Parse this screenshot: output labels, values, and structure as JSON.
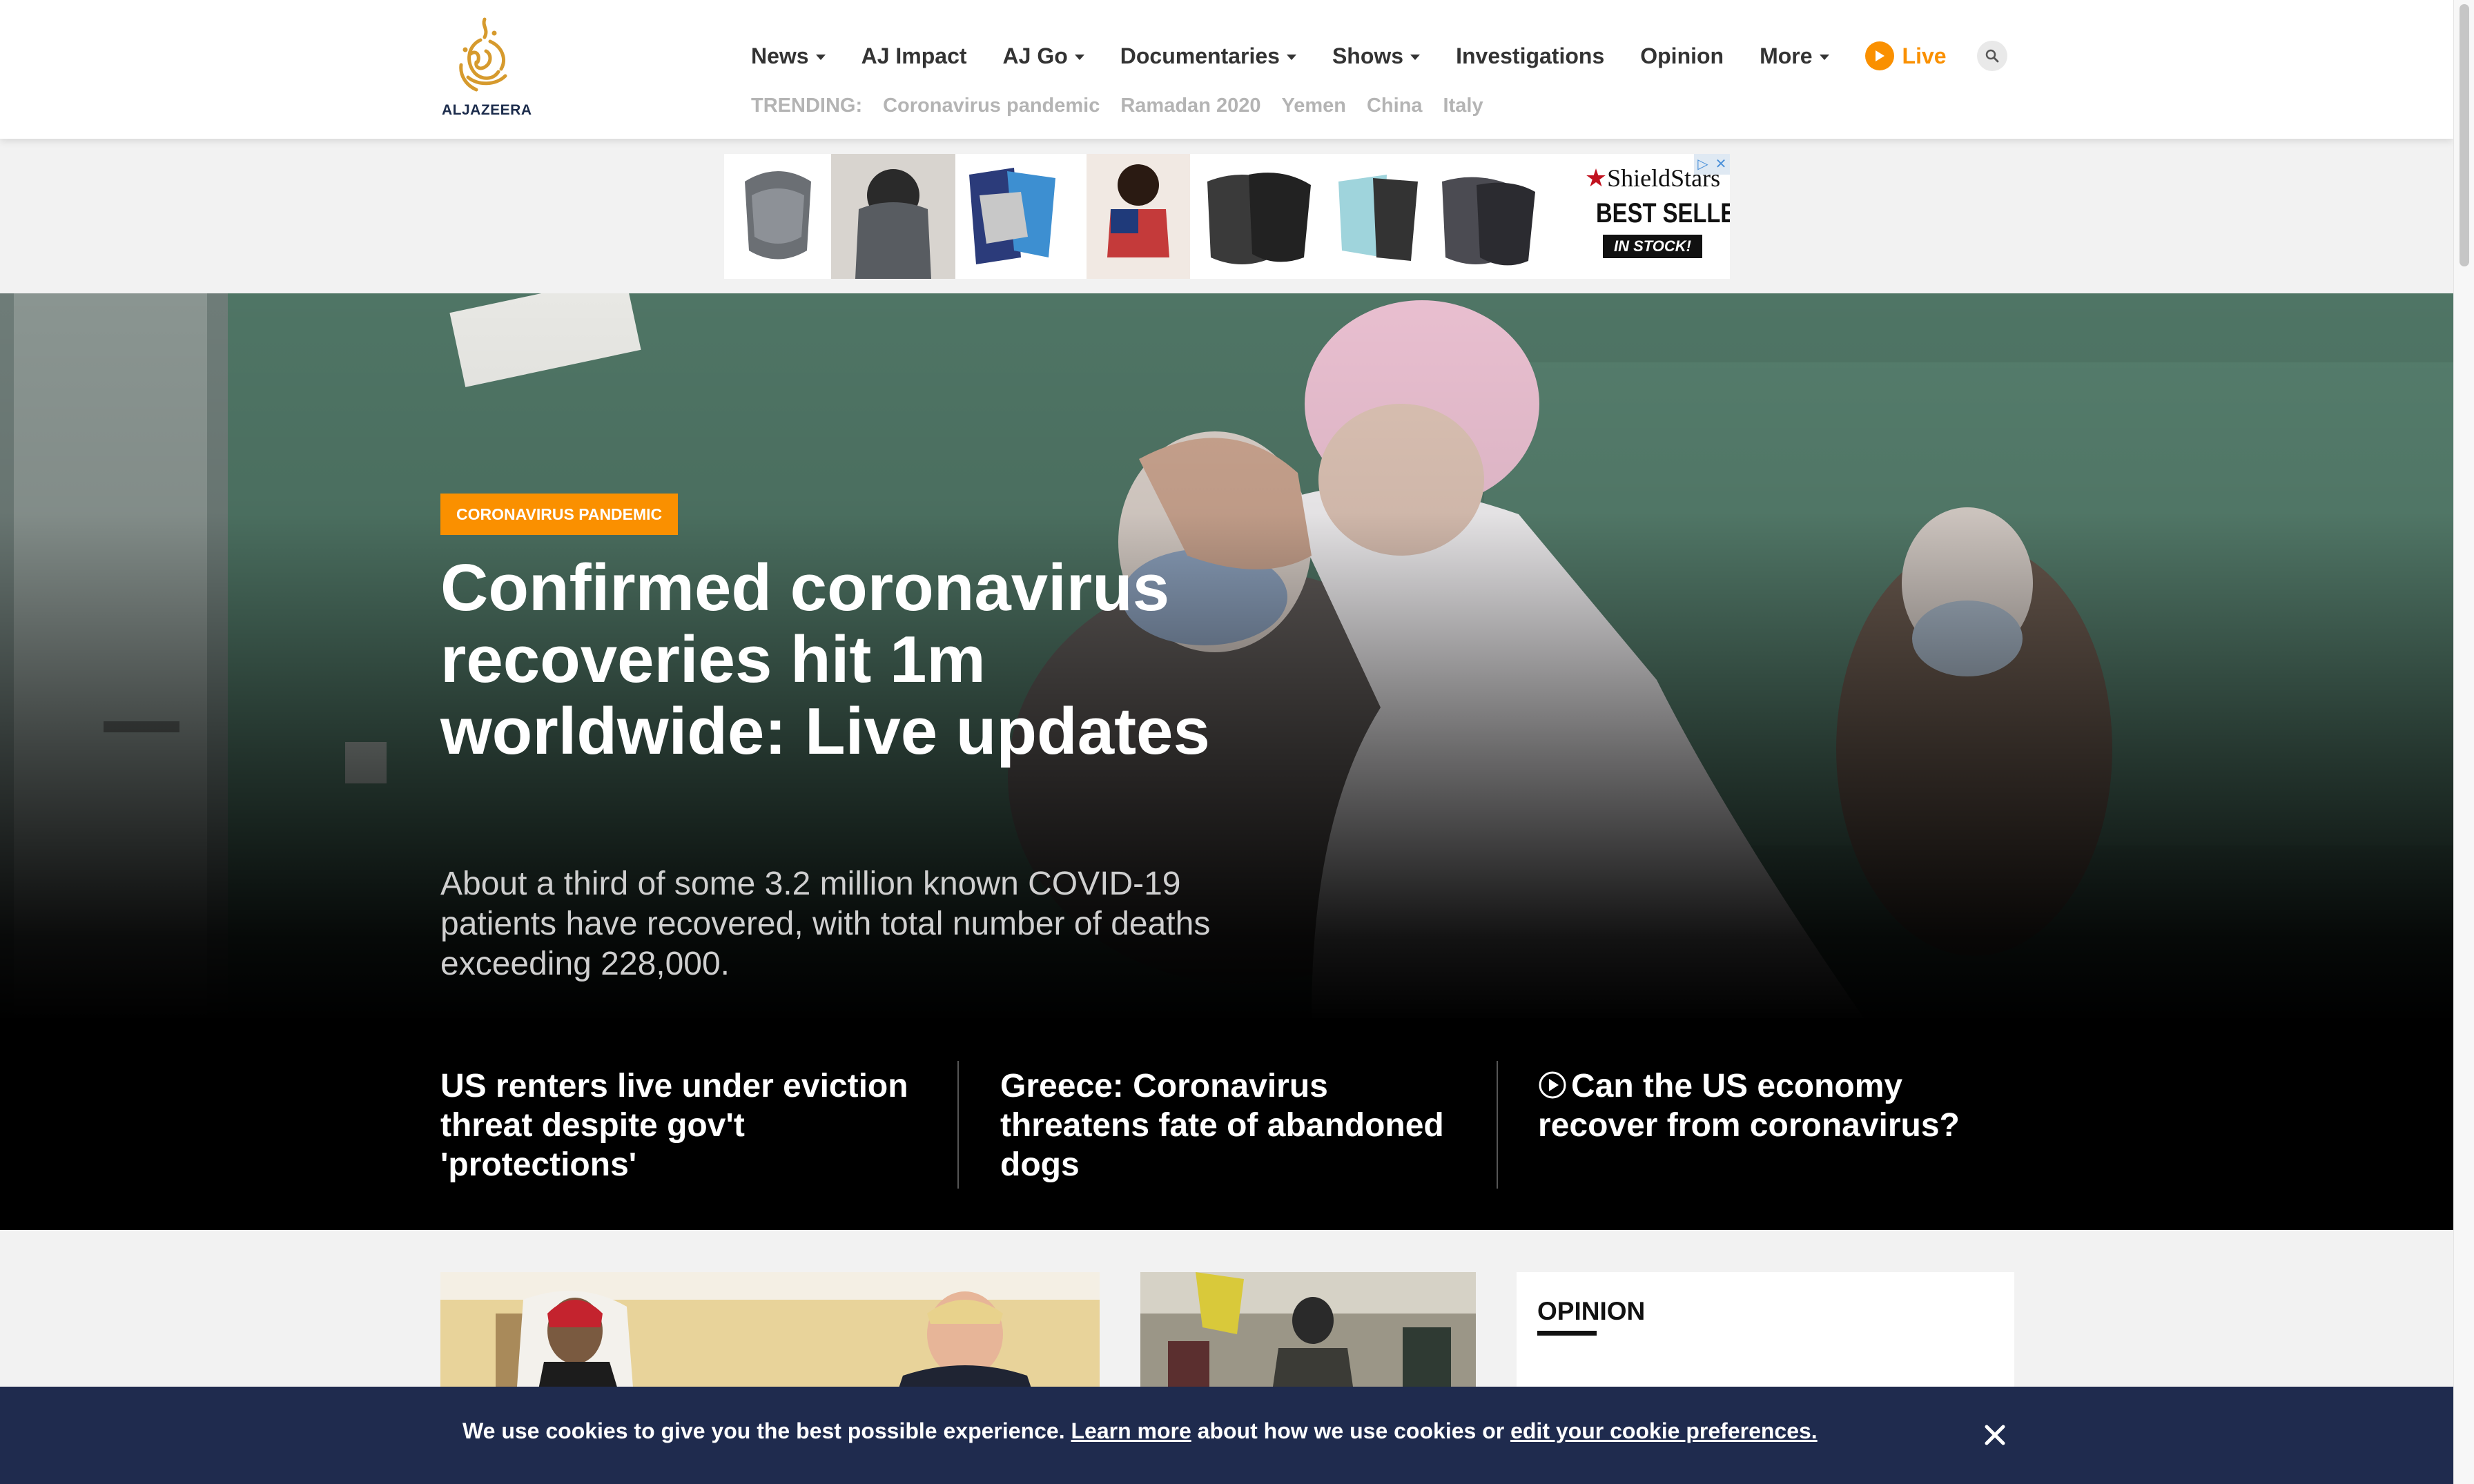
{
  "brand": {
    "name": "ALJAZEERA",
    "color": "#fa9000"
  },
  "nav": {
    "items": [
      {
        "label": "News",
        "dropdown": true
      },
      {
        "label": "AJ Impact",
        "dropdown": false
      },
      {
        "label": "AJ Go",
        "dropdown": true
      },
      {
        "label": "Documentaries",
        "dropdown": true
      },
      {
        "label": "Shows",
        "dropdown": true
      },
      {
        "label": "Investigations",
        "dropdown": false
      },
      {
        "label": "Opinion",
        "dropdown": false
      },
      {
        "label": "More",
        "dropdown": true
      }
    ],
    "live_label": "Live",
    "search_icon": "search-icon"
  },
  "trending": {
    "label": "TRENDING:",
    "items": [
      "Coronavirus pandemic",
      "Ramadan 2020",
      "Yemen",
      "China",
      "Italy"
    ]
  },
  "ad": {
    "brand": "ShieldStars",
    "headline": "BEST SELLER",
    "badge": "IN STOCK!"
  },
  "hero": {
    "tag": "CORONAVIRUS PANDEMIC",
    "title": "Confirmed coronavirus recoveries hit 1m worldwide: Live updates",
    "summary": "About a third of some 3.2 million known COVID-19 patients have recovered, with total number of deaths exceeding 228,000."
  },
  "sub_stories": [
    {
      "title": "US renters live under eviction threat despite gov't 'protections'",
      "video": false
    },
    {
      "title": "Greece: Coronavirus threatens fate of abandoned dogs",
      "video": false
    },
    {
      "title": "Can the US economy recover from coronavirus?",
      "video": true
    }
  ],
  "opinion": {
    "title": "OPINION"
  },
  "cookie": {
    "text_1": "We use cookies to give you the best possible experience. ",
    "link_1": "Learn more",
    "text_2": " about how we use cookies or ",
    "link_2": "edit your cookie preferences.",
    "close_icon": "close-icon"
  }
}
